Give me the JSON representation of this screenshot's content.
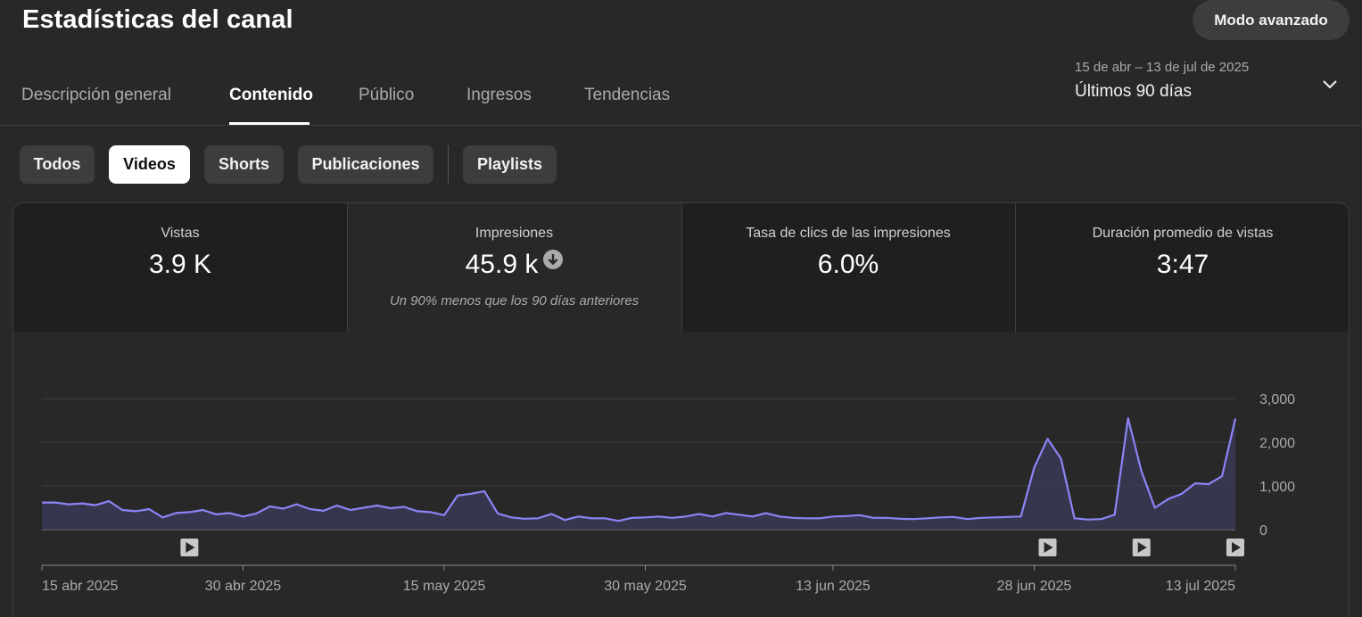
{
  "header": {
    "title": "Estadísticas del canal",
    "advanced_mode_label": "Modo avanzado"
  },
  "tabs": [
    {
      "label": "Descripción general",
      "active": false
    },
    {
      "label": "Contenido",
      "active": true
    },
    {
      "label": "Público",
      "active": false
    },
    {
      "label": "Ingresos",
      "active": false
    },
    {
      "label": "Tendencias",
      "active": false
    }
  ],
  "date_picker": {
    "range": "15 de abr – 13 de jul de 2025",
    "label": "Últimos 90 días",
    "icon": "chevron-down-icon"
  },
  "chips": [
    {
      "label": "Todos",
      "active": false
    },
    {
      "label": "Videos",
      "active": true
    },
    {
      "label": "Shorts",
      "active": false
    },
    {
      "label": "Publicaciones",
      "active": false
    },
    {
      "label": "Playlists",
      "active": false
    }
  ],
  "metrics": [
    {
      "label": "Vistas",
      "value": "3.9 K",
      "note": ""
    },
    {
      "label": "Impresiones",
      "value": "45.9 k",
      "note": "Un 90% menos que los 90 días anteriores",
      "icon": "down-arrow-icon"
    },
    {
      "label": "Tasa de clics de las impresiones",
      "value": "6.0%",
      "note": ""
    },
    {
      "label": "Duración promedio de vistas",
      "value": "3:47",
      "note": ""
    }
  ],
  "colors": {
    "line": "#8c84f5",
    "area": "#3a3856",
    "background": "#282828",
    "active_tab": "#ffffff"
  },
  "chart_data": {
    "type": "line",
    "series": [
      {
        "name": "",
        "start_date": "15 abr 2025",
        "values": [
          620,
          620,
          580,
          600,
          560,
          650,
          450,
          420,
          470,
          280,
          380,
          400,
          450,
          350,
          380,
          300,
          370,
          530,
          480,
          580,
          470,
          430,
          550,
          450,
          500,
          550,
          490,
          520,
          420,
          400,
          330,
          780,
          820,
          880,
          370,
          280,
          250,
          260,
          360,
          220,
          300,
          260,
          260,
          200,
          270,
          280,
          300,
          270,
          300,
          360,
          300,
          380,
          340,
          300,
          380,
          300,
          270,
          260,
          260,
          300,
          310,
          330,
          270,
          270,
          250,
          240,
          260,
          280,
          290,
          240,
          270,
          280,
          290,
          300,
          1420,
          2080,
          1620,
          260,
          230,
          240,
          340,
          2550,
          1330,
          500,
          700,
          820,
          1060,
          1040,
          1220,
          2540
        ]
      }
    ],
    "x_tick_labels": [
      "15 abr 2025",
      "30 abr 2025",
      "15 may 2025",
      "30 may 2025",
      "13 jun 2025",
      "28 jun 2025",
      "13 jul 2025"
    ],
    "y_tick_labels": [
      "0",
      "1,000",
      "2,000",
      "3,000"
    ],
    "ylim": [
      0,
      3000
    ],
    "grid": true,
    "video_markers_day_index": [
      11,
      75,
      82,
      89
    ]
  }
}
